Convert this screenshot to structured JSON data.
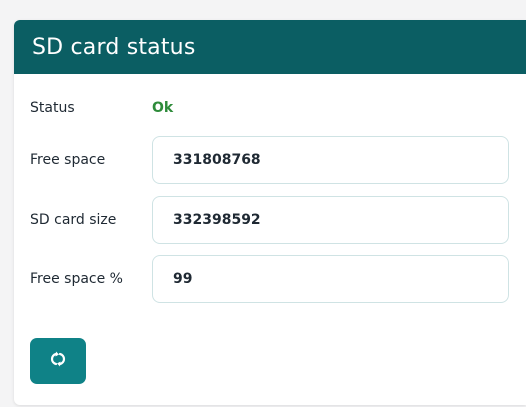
{
  "card": {
    "title": "SD card status"
  },
  "rows": {
    "status": {
      "label": "Status",
      "value": "Ok"
    },
    "free_space": {
      "label": "Free space",
      "value": "331808768"
    },
    "card_size": {
      "label": "SD card size",
      "value": "332398592"
    },
    "free_percent": {
      "label": "Free space %",
      "value": "99"
    }
  },
  "refresh_button": {
    "icon": "refresh-icon"
  },
  "colors": {
    "header": "#0b5e63",
    "button": "#0f8287",
    "status_ok": "#2e8b3a"
  }
}
